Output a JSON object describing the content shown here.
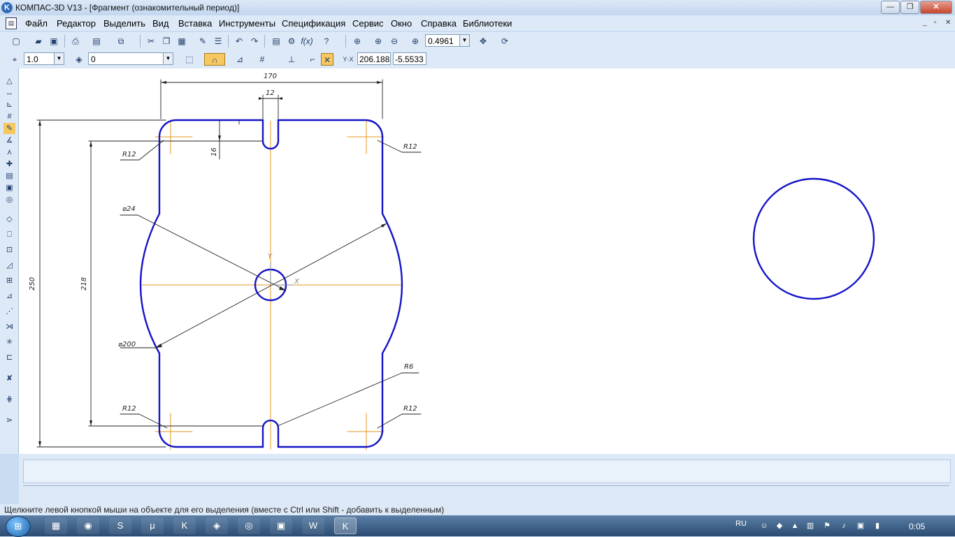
{
  "window": {
    "title": "КОМПАС-3D V13 - [Фрагмент (ознакомительный период)]",
    "logo": "K",
    "minimize": "—",
    "maximize": "❐",
    "close": "✕"
  },
  "menu": {
    "items": [
      "Файл",
      "Редактор",
      "Выделить",
      "Вид",
      "Вставка",
      "Инструменты",
      "Спецификация",
      "Сервис",
      "Окно",
      "Справка",
      "Библиотеки"
    ],
    "mdi_min": "_",
    "mdi_restore": "▫",
    "mdi_close": "✕"
  },
  "toolbar_main": {
    "zoom_value": "0.4961"
  },
  "toolbar_current": {
    "step_value": "1.0",
    "layer_value": "0",
    "coord_x": "206.188",
    "coord_y": "-5.5533"
  },
  "drawing": {
    "dimensions": {
      "width": "170",
      "slot": "12",
      "slot_depth": "16",
      "height_total": "250",
      "height_inner": "218",
      "hole_dia": "⌀24",
      "arc_dia": "⌀200",
      "r_top_left": "R12",
      "r_top_right": "R12",
      "r_bottom_left": "R12",
      "r_bottom_right": "R12",
      "r_slot": "R6"
    },
    "axis_x": "X",
    "axis_y": "Y",
    "colors": {
      "contour": "#1414c8",
      "centerline": "#e39a1e",
      "dimension": "#222222"
    }
  },
  "status_bar": {
    "hint": "Щелкните левой кнопкой мыши на объекте для его выделения (вместе с Ctrl или Shift - добавить к выделенным)"
  },
  "taskbar": {
    "language": "RU",
    "clock": "0:05",
    "apps": [
      {
        "name": "calculator-icon",
        "glyph": "▦"
      },
      {
        "name": "firefox-icon",
        "glyph": "◉"
      },
      {
        "name": "skype-icon",
        "glyph": "S"
      },
      {
        "name": "torrent-icon",
        "glyph": "μ"
      },
      {
        "name": "app-k-icon",
        "glyph": "K"
      },
      {
        "name": "game-icon",
        "glyph": "◈"
      },
      {
        "name": "chrome-icon",
        "glyph": "◎"
      },
      {
        "name": "explorer-icon",
        "glyph": "▣"
      },
      {
        "name": "word-icon",
        "glyph": "W"
      },
      {
        "name": "kompas-icon",
        "glyph": "K"
      }
    ]
  }
}
